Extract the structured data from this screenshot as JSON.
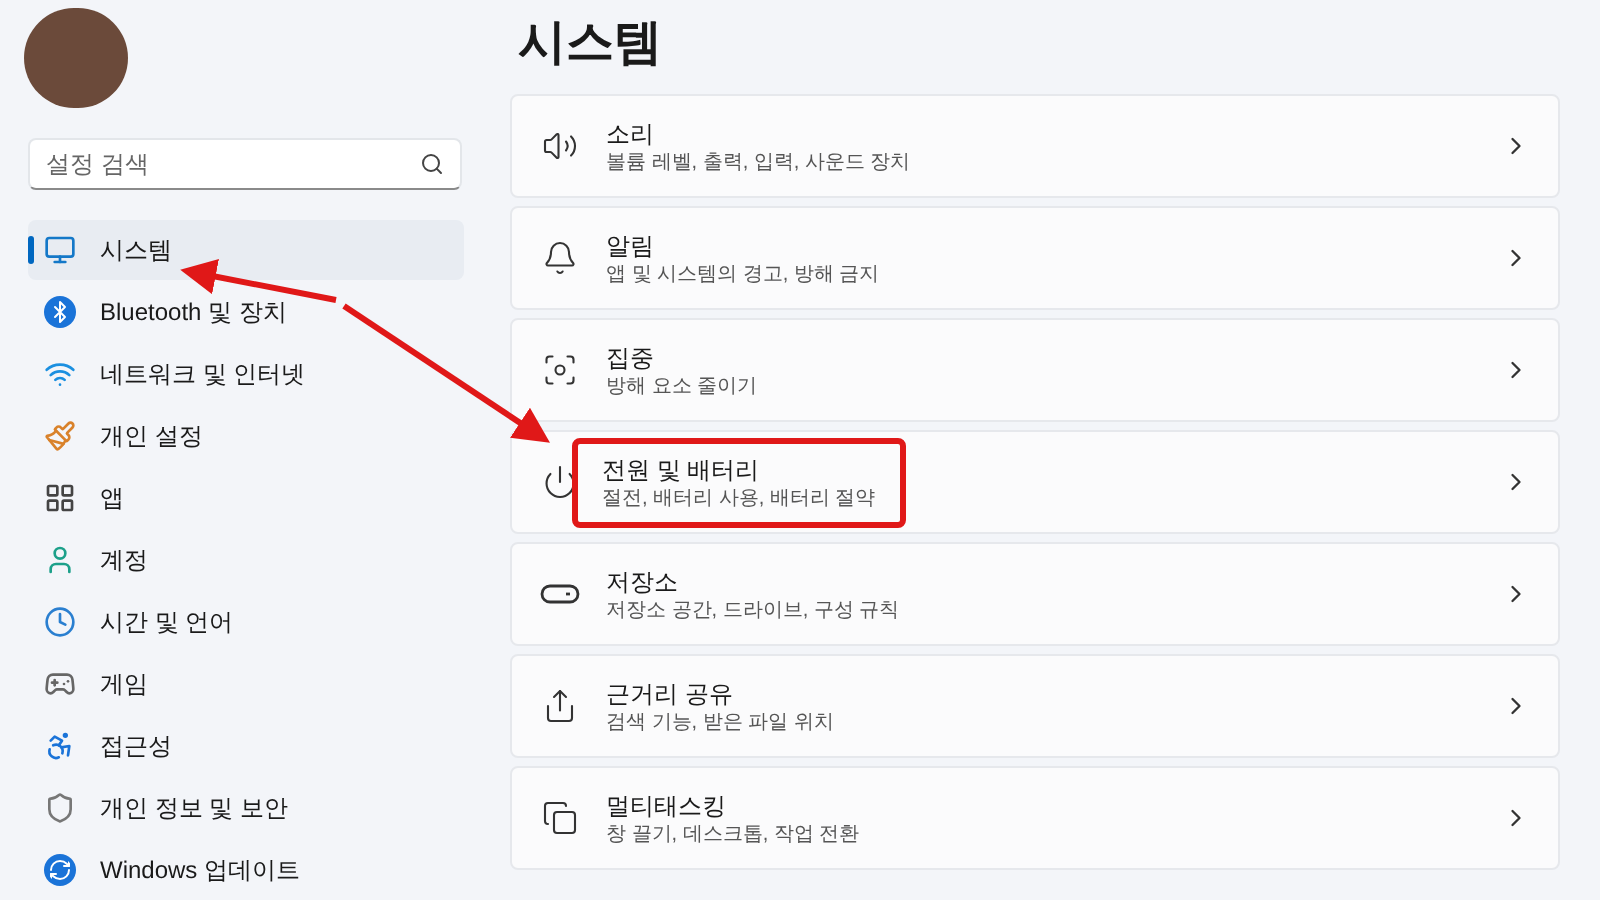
{
  "sidebar": {
    "search": {
      "placeholder": "설정 검색"
    },
    "items": [
      {
        "label": "시스템",
        "selected": true
      },
      {
        "label": "Bluetooth 및 장치",
        "selected": false
      },
      {
        "label": "네트워크 및 인터넷",
        "selected": false
      },
      {
        "label": "개인 설정",
        "selected": false
      },
      {
        "label": "앱",
        "selected": false
      },
      {
        "label": "계정",
        "selected": false
      },
      {
        "label": "시간 및 언어",
        "selected": false
      },
      {
        "label": "게임",
        "selected": false
      },
      {
        "label": "접근성",
        "selected": false
      },
      {
        "label": "개인 정보 및 보안",
        "selected": false
      },
      {
        "label": "Windows 업데이트",
        "selected": false
      }
    ]
  },
  "page": {
    "title": "시스템",
    "cards": [
      {
        "title": "소리",
        "subtitle": "볼륨 레벨, 출력, 입력, 사운드 장치",
        "annotated": false
      },
      {
        "title": "알림",
        "subtitle": "앱 및 시스템의 경고, 방해 금지",
        "annotated": false
      },
      {
        "title": "집중",
        "subtitle": "방해 요소 줄이기",
        "annotated": false
      },
      {
        "title": "전원 및 배터리",
        "subtitle": "절전, 배터리 사용, 배터리 절약",
        "annotated": true
      },
      {
        "title": "저장소",
        "subtitle": "저장소 공간, 드라이브, 구성 규칙",
        "annotated": false
      },
      {
        "title": "근거리 공유",
        "subtitle": "검색 기능, 받은 파일 위치",
        "annotated": false
      },
      {
        "title": "멀티태스킹",
        "subtitle": "창 끌기, 데스크톱, 작업 전환",
        "annotated": false
      }
    ]
  }
}
